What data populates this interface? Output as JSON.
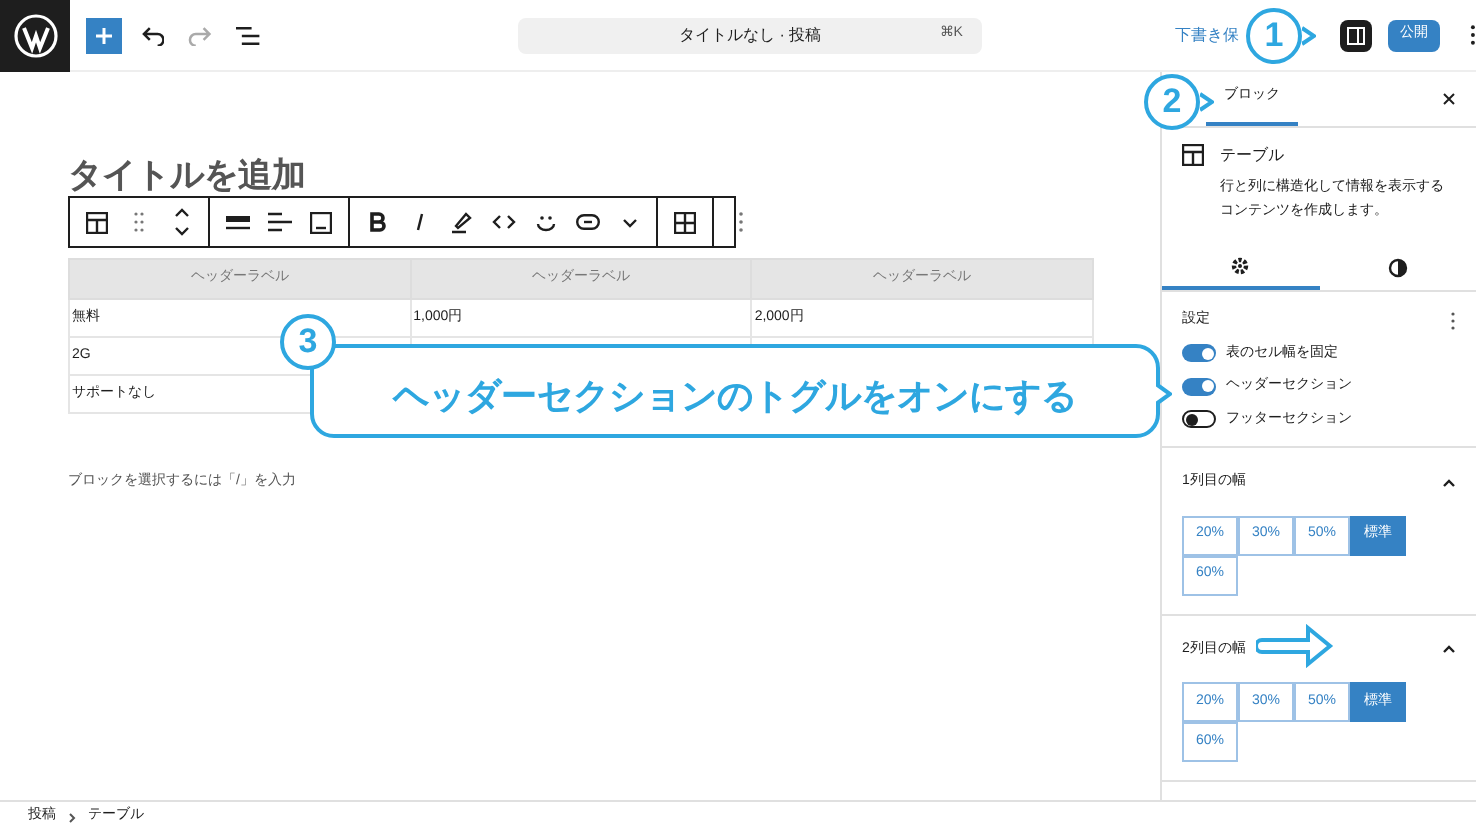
{
  "topbar": {
    "command_bar": {
      "title": "タイトルなし · 投稿",
      "shortcut": "⌘K"
    },
    "save_draft": "下書き保",
    "publish": "公開"
  },
  "editor": {
    "title_placeholder": "タイトルを追加",
    "table": {
      "columns": [
        "ヘッダーラベル",
        "ヘッダーラベル",
        "ヘッダーラベル"
      ],
      "rows": [
        [
          "無料",
          "1,000円",
          "2,000円"
        ],
        [
          "2G"
        ],
        [
          "サポートなし"
        ]
      ]
    },
    "appender_placeholder": "ブロックを選択するには「/」を入力"
  },
  "sidebar": {
    "tab": "ブロック",
    "block_name": "テーブル",
    "block_description": "行と列に構造化して情報を表示するコンテンツを作成します。",
    "tabs": [
      {
        "kind": "settings",
        "selected": true
      },
      {
        "kind": "styles",
        "selected": false
      }
    ],
    "settings_title": "設定",
    "toggles": [
      {
        "label": "表のセル幅を固定",
        "on": true
      },
      {
        "label": "ヘッダーセクション",
        "on": true
      },
      {
        "label": "フッターセクション",
        "on": false
      }
    ],
    "width_panels": [
      {
        "title": "1列目の幅",
        "options": [
          {
            "label": "20%",
            "selected": false
          },
          {
            "label": "30%",
            "selected": false
          },
          {
            "label": "50%",
            "selected": false
          },
          {
            "label": "標準",
            "selected": true
          },
          {
            "label": "60%",
            "selected": false
          }
        ]
      },
      {
        "title": "2列目の幅",
        "options": [
          {
            "label": "20%",
            "selected": false
          },
          {
            "label": "30%",
            "selected": false
          },
          {
            "label": "50%",
            "selected": false
          },
          {
            "label": "標準",
            "selected": true
          },
          {
            "label": "60%",
            "selected": false
          }
        ]
      }
    ]
  },
  "breadcrumb": [
    "投稿",
    "テーブル"
  ],
  "annotations": {
    "steps": [
      "1",
      "2",
      "3"
    ],
    "callout": "ヘッダーセクションのトグルをオンにする"
  }
}
